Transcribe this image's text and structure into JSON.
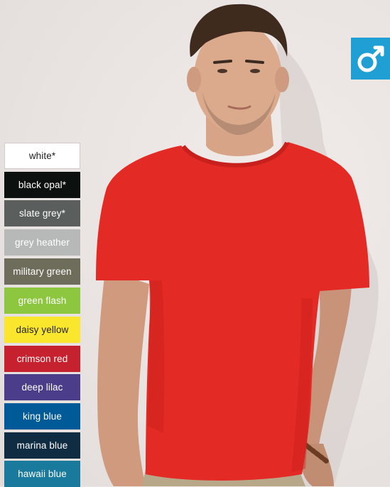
{
  "badge": {
    "icon": "male-symbol-icon",
    "color": "#1f9fd3",
    "symbol": "♂"
  },
  "product": {
    "garment_color": "crimson red"
  },
  "swatches": [
    {
      "label": "white*",
      "color": "#ffffff",
      "text_color": "#222222"
    },
    {
      "label": "black opal*",
      "color": "#0c100e",
      "text_color": "#ffffff"
    },
    {
      "label": "slate grey*",
      "color": "#5a5f5e",
      "text_color": "#ffffff"
    },
    {
      "label": "grey heather",
      "color": "#b7b8b8",
      "text_color": "#ffffff"
    },
    {
      "label": "military green",
      "color": "#6e6d5c",
      "text_color": "#ffffff"
    },
    {
      "label": "green flash",
      "color": "#8dc63f",
      "text_color": "#ffffff"
    },
    {
      "label": "daisy yellow",
      "color": "#fbe62e",
      "text_color": "#222222"
    },
    {
      "label": "crimson red",
      "color": "#c6212e",
      "text_color": "#ffffff"
    },
    {
      "label": "deep lilac",
      "color": "#4c3d8a",
      "text_color": "#ffffff"
    },
    {
      "label": "king blue",
      "color": "#005a98",
      "text_color": "#ffffff"
    },
    {
      "label": "marina blue",
      "color": "#0f2c43",
      "text_color": "#ffffff"
    },
    {
      "label": "hawaii blue",
      "color": "#1a7a9e",
      "text_color": "#ffffff"
    }
  ]
}
